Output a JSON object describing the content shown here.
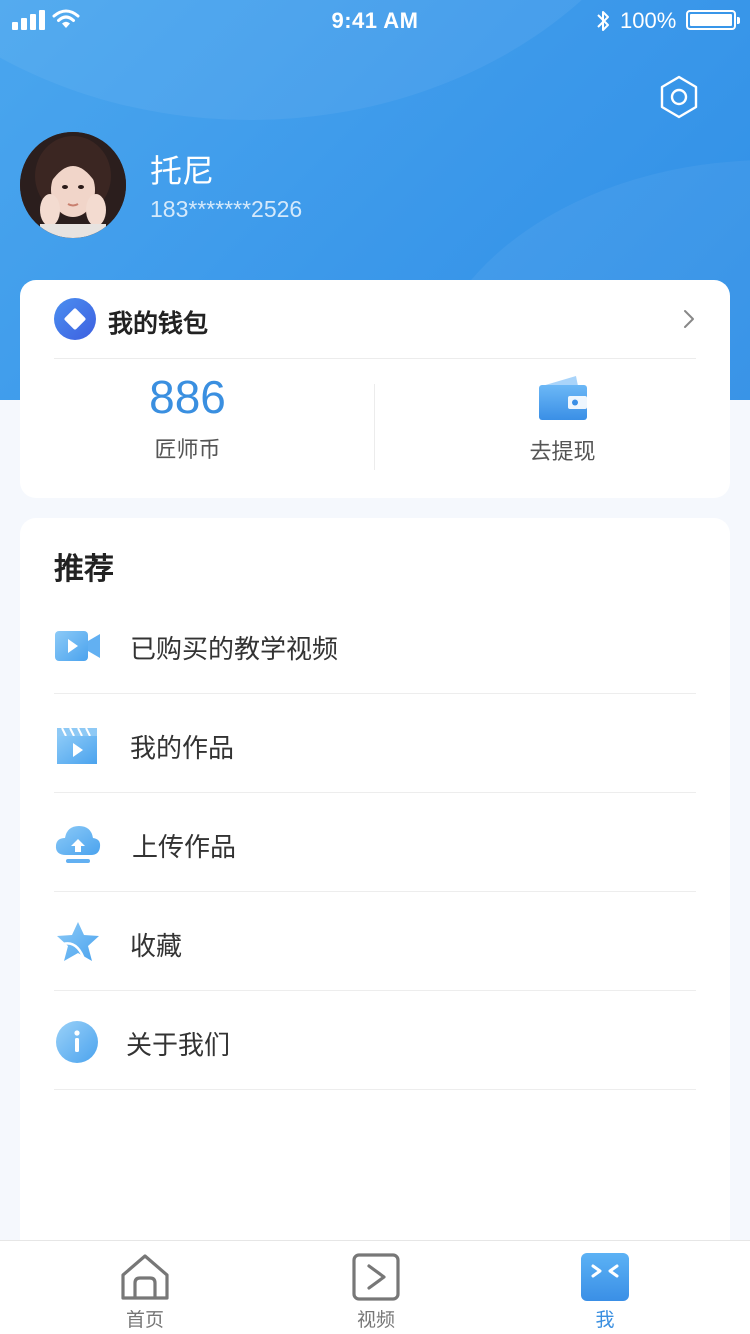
{
  "status_bar": {
    "time": "9:41 AM",
    "battery": "100%"
  },
  "profile": {
    "name": "托尼",
    "phone": "183*******2526"
  },
  "wallet": {
    "title": "我的钱包",
    "coins_value": "886",
    "coins_label": "匠师币",
    "withdraw_label": "去提现"
  },
  "recommend": {
    "title": "推荐",
    "items": [
      {
        "label": "已购买的教学视频",
        "icon": "video-camera-icon"
      },
      {
        "label": "我的作品",
        "icon": "clapperboard-icon"
      },
      {
        "label": "上传作品",
        "icon": "cloud-upload-icon"
      },
      {
        "label": "收藏",
        "icon": "star-icon"
      },
      {
        "label": "关于我们",
        "icon": "info-icon"
      }
    ]
  },
  "tabs": [
    {
      "label": "首页",
      "icon": "home-icon",
      "active": false
    },
    {
      "label": "视频",
      "icon": "video-play-icon",
      "active": false
    },
    {
      "label": "我",
      "icon": "profile-icon",
      "active": true
    }
  ],
  "colors": {
    "primary": "#3b98ea",
    "accent_text": "#3a8fe0",
    "icon_light": "#7fc0f3"
  }
}
